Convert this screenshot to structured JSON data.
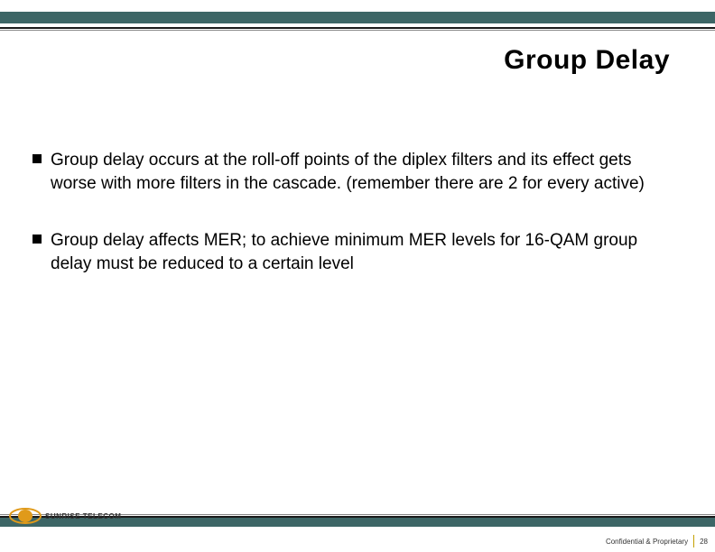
{
  "title": "Group Delay",
  "bullets": [
    "Group delay occurs at the roll-off points of the diplex filters and its effect gets worse with more filters in the cascade. (remember there are 2 for every active)",
    "Group delay affects MER; to achieve minimum MER levels for 16-QAM group delay must be reduced to a certain level"
  ],
  "logo": {
    "brand": "SUNRISE TELECOM"
  },
  "footer": {
    "confidential": "Confidential & Proprietary",
    "page": "28"
  }
}
